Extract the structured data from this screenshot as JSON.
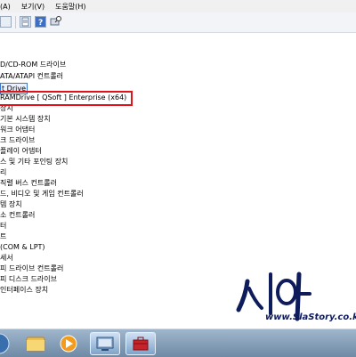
{
  "menu": {
    "items": [
      "(A)",
      "보기(V)",
      "도움말(H)"
    ]
  },
  "tree": {
    "rows": [
      "D/CD-ROM 드라이브",
      "ATA/ATAPI 컨트롤러",
      "t Drive",
      "RAMDrive [ QSoft ] Enterprise (x64)",
      "장치",
      "기본 시스템 장치",
      "워크 어댑터",
      "크 드라이브",
      "플레이 어댑터",
      "스 및 기타 포인팅 장치",
      "리",
      "직렬 버스 컨트롤러",
      "드, 비디오 및 게임 컨트롤러",
      "템 장치",
      "소 컨트롤러",
      "터",
      "트",
      "(COM & LPT)",
      "세서",
      "피 드라이브 컨트롤러",
      "피 디스크 드라이브",
      "인터페이스 장치"
    ]
  },
  "watermark": {
    "url": "www.SlaStory.co.kr",
    "logo": "시아 brush logo"
  },
  "colors": {
    "highlight": "#e0141b",
    "watermark_blue": "#0e1c5c"
  },
  "icons": [
    "back-icon",
    "forward-icon",
    "properties-icon",
    "help-icon",
    "scan-hardware-icon",
    "explorer-icon",
    "media-player-icon",
    "device-manager-icon",
    "toolbox-icon"
  ]
}
